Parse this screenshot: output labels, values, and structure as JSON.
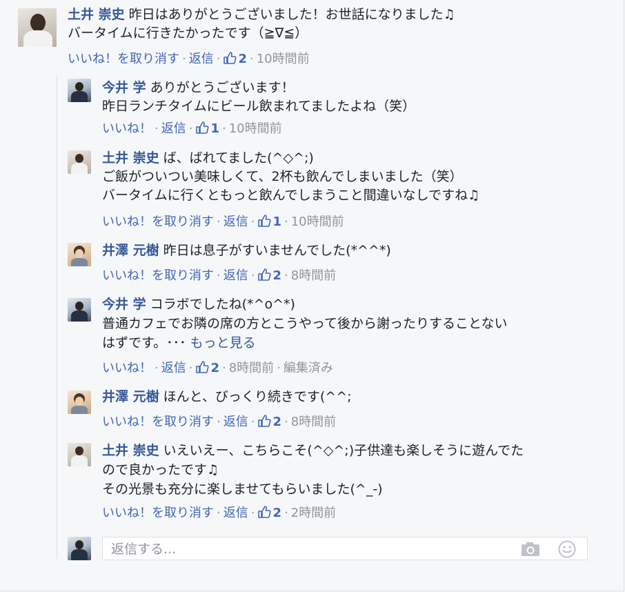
{
  "thread": {
    "main": {
      "author": "土井 崇史",
      "lines": [
        "昨日はありがとうございました！お世話になりました♫",
        "バータイムに行きたかったです（≧∇≦）"
      ],
      "like_action": "いいね！を取り消す",
      "reply_action": "返信",
      "likes": "2",
      "time": "10時間前"
    },
    "replies": [
      {
        "author": "今井 学",
        "lines": [
          "ありがとうございます！",
          "昨日ランチタイムにビール飲まれてましたよね（笑）"
        ],
        "like_action": "いいね！",
        "reply_action": "返信",
        "likes": "1",
        "time": "10時間前"
      },
      {
        "author": "土井 崇史",
        "lines": [
          "ば、ばれてました(^◇^;)",
          "ご飯がついつい美味しくて、2杯も飲んでしまいました（笑）",
          "バータイムに行くともっと飲んでしまうこと間違いなしですね♫"
        ],
        "like_action": "いいね！を取り消す",
        "reply_action": "返信",
        "likes": "1",
        "time": "10時間前"
      },
      {
        "author": "井澤 元樹",
        "lines": [
          "昨日は息子がすいませんでした(*^^*)"
        ],
        "like_action": "いいね！を取り消す",
        "reply_action": "返信",
        "likes": "2",
        "time": "8時間前"
      },
      {
        "author": "今井 学",
        "lines": [
          "コラボでしたね(*^o^*)",
          "普通カフェでお隣の席の方とこうやって後から謝ったりすることない",
          "はずです。･･･"
        ],
        "see_more": "もっと見る",
        "like_action": "いいね！",
        "reply_action": "返信",
        "likes": "2",
        "time": "8時間前",
        "edited": "編集済み"
      },
      {
        "author": "井澤 元樹",
        "lines": [
          "ほんと、びっくり続きです(^^;"
        ],
        "like_action": "いいね！を取り消す",
        "reply_action": "返信",
        "likes": "2",
        "time": "8時間前"
      },
      {
        "author": "土井 崇史",
        "lines": [
          "いえいえー、こちらこそ(^◇^;)子供達も楽しそうに遊んでた",
          "ので良かったです♫",
          "その光景も充分に楽しませてもらいました(^_-)"
        ],
        "like_action": "いいね！を取り消す",
        "reply_action": "返信",
        "likes": "2",
        "time": "2時間前"
      }
    ],
    "reply_box": {
      "placeholder": "返信する..."
    },
    "colors": {
      "link": "#365899",
      "action": "#4267b2",
      "meta": "#90949c",
      "text": "#1d2129"
    },
    "icons": [
      "thumbs-up-icon",
      "camera-icon",
      "smiley-icon"
    ]
  }
}
